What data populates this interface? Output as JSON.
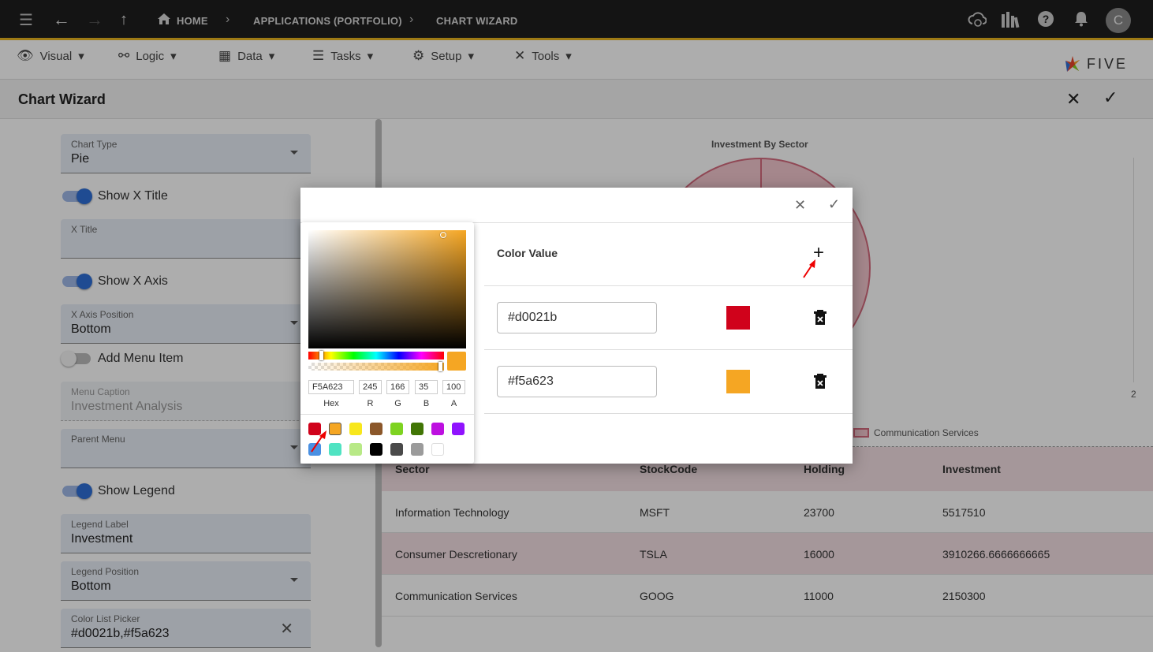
{
  "topbar": {
    "crumbs": [
      "HOME",
      "APPLICATIONS (PORTFOLIO)",
      "CHART WIZARD"
    ],
    "avatar": "C"
  },
  "menu": {
    "items": [
      "Visual",
      "Logic",
      "Data",
      "Tasks",
      "Setup",
      "Tools"
    ],
    "logo": "FIVE"
  },
  "wizard": {
    "title": "Chart Wizard"
  },
  "form": {
    "chart_type_label": "Chart Type",
    "chart_type_value": "Pie",
    "show_x_title": "Show X Title",
    "x_title_label": "X Title",
    "show_x_axis": "Show X Axis",
    "x_axis_position_label": "X Axis Position",
    "x_axis_position_value": "Bottom",
    "add_menu_item": "Add Menu Item",
    "menu_caption_label": "Menu Caption",
    "menu_caption_value": "Investment Analysis",
    "parent_menu_label": "Parent Menu",
    "show_legend": "Show Legend",
    "legend_label_label": "Legend Label",
    "legend_label_value": "Investment",
    "legend_position_label": "Legend Position",
    "legend_position_value": "Bottom",
    "color_list_label": "Color List Picker",
    "color_list_value": "#d0021b,#f5a623"
  },
  "chart": {
    "title": "Investment By Sector",
    "tick": "2",
    "legend_item": "Communication Services"
  },
  "table": {
    "headers": [
      "Sector",
      "StockCode",
      "Holding",
      "Investment"
    ],
    "rows": [
      [
        "Information Technology",
        "MSFT",
        "23700",
        "5517510"
      ],
      [
        "Consumer Descretionary",
        "TSLA",
        "16000",
        "3910266.6666666665"
      ],
      [
        "Communication Services",
        "GOOG",
        "11000",
        "2150300"
      ]
    ]
  },
  "dialog": {
    "color_value_title": "Color Value",
    "colors": [
      "#d0021b",
      "#f5a623"
    ]
  },
  "picker": {
    "hex": "F5A623",
    "r": "245",
    "g": "166",
    "b": "35",
    "a": "100",
    "labels": [
      "Hex",
      "R",
      "G",
      "B",
      "A"
    ],
    "swatches": [
      "#d0021b",
      "#f5a623",
      "#f8e71c",
      "#8b572a",
      "#7ed321",
      "#417505",
      "#bd10e0",
      "#9013fe",
      "#4a90e2",
      "#50e3c2",
      "#b8e986",
      "#000000",
      "#4a4a4a",
      "#9b9b9b",
      "#ffffff"
    ]
  }
}
